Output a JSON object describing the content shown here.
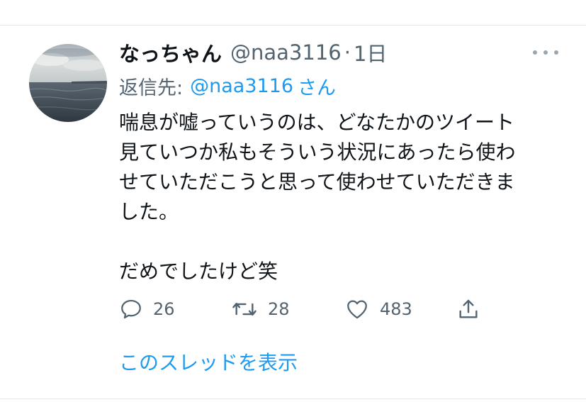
{
  "tweet": {
    "display_name": "なっちゃん",
    "handle": "@naa3116",
    "separator": "·",
    "time": "1日",
    "reply_prefix": "返信先:",
    "reply_handle": "@naa3116",
    "reply_suffix": "さん",
    "body_lines": [
      "喘息が嘘っていうのは、どなたかのツイート",
      "見ていつか私もそういう状況にあったら使わ",
      "せていただこうと思って使わせていただきま",
      "した。",
      "だめでしたけど笑"
    ],
    "more_icon": "more-horizontal-icon"
  },
  "actions": {
    "reply": {
      "icon": "reply-icon",
      "count": "26"
    },
    "retweet": {
      "icon": "retweet-icon",
      "count": "28"
    },
    "like": {
      "icon": "heart-icon",
      "count": "483"
    },
    "share": {
      "icon": "share-icon"
    }
  },
  "thread_link": "このスレッドを表示",
  "colors": {
    "text": "#0f1419",
    "secondary": "#536471",
    "accent": "#1d9bf0",
    "divider": "#e6e9ec"
  }
}
